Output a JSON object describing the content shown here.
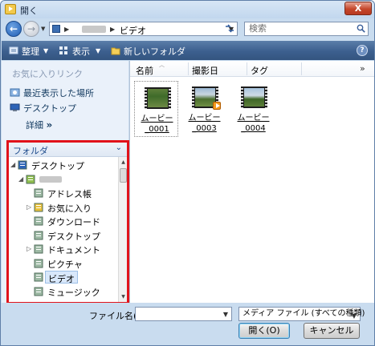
{
  "window": {
    "title": "開く",
    "close_label": "X"
  },
  "nav": {
    "back_label": "←",
    "forward_label": "→",
    "address": {
      "segments": [
        "",
        "ビデオ"
      ],
      "separator": "▶"
    },
    "search_placeholder": "検索"
  },
  "toolbar": {
    "organize_label": "整理",
    "views_label": "表示",
    "new_folder_label": "新しいフォルダ",
    "help_label": "?"
  },
  "favorites": {
    "header": "お気に入りリンク",
    "items": [
      {
        "label": "最近表示した場所",
        "icon": "recent-places-icon"
      },
      {
        "label": "デスクトップ",
        "icon": "desktop-icon"
      }
    ],
    "more_label": "詳細",
    "more_glyph": "»"
  },
  "folders": {
    "header": "フォルダ",
    "tree": [
      {
        "label": "デスクトップ",
        "icon": "desktop-icon",
        "expander": "◢"
      },
      {
        "label": "",
        "icon": "user-folder-icon",
        "expander": "◢"
      },
      {
        "label": "アドレス帳",
        "icon": "contacts-folder-icon",
        "expander": ""
      },
      {
        "label": "お気に入り",
        "icon": "favorites-folder-icon",
        "expander": "▷"
      },
      {
        "label": "ダウンロード",
        "icon": "downloads-folder-icon",
        "expander": ""
      },
      {
        "label": "デスクトップ",
        "icon": "desktop-folder-icon",
        "expander": ""
      },
      {
        "label": "ドキュメント",
        "icon": "documents-folder-icon",
        "expander": "▷"
      },
      {
        "label": "ピクチャ",
        "icon": "pictures-folder-icon",
        "expander": ""
      },
      {
        "label": "ビデオ",
        "icon": "videos-folder-icon",
        "expander": "",
        "selected": true
      },
      {
        "label": "ミュージック",
        "icon": "music-folder-icon",
        "expander": ""
      }
    ]
  },
  "columns": {
    "name": "名前",
    "date_taken": "撮影日",
    "tags": "タグ",
    "more": "»"
  },
  "files": [
    {
      "line1": "ムービー",
      "line2": "_0001",
      "icon": "video-file-icon",
      "selected": true,
      "badge": false
    },
    {
      "line1": "ムービー",
      "line2": "_0003",
      "icon": "video-file-icon",
      "selected": false,
      "badge": true
    },
    {
      "line1": "ムービー",
      "line2": "_0004",
      "icon": "video-file-icon",
      "selected": false,
      "badge": false
    }
  ],
  "bottom": {
    "filename_label": "ファイル名(N):",
    "filename_value": "",
    "filetype_value": "メディア ファイル (すべての種類)",
    "open_label": "開く(O)",
    "cancel_label": "キャンセル"
  },
  "colors": {
    "highlight_box": "#e1121a",
    "toolbar_bg": "#3c5f8f",
    "chrome_bg": "#c9dcef"
  }
}
